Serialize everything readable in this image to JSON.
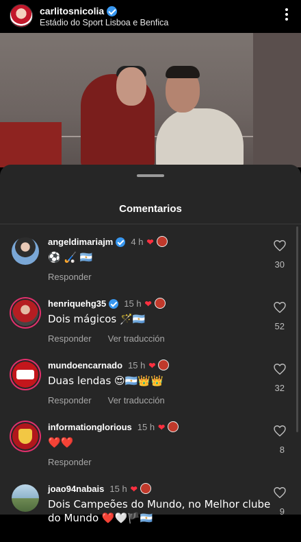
{
  "header": {
    "username": "carlitosnicolia",
    "location": "Estádio do Sport Lisboa e Benfica"
  },
  "sheet": {
    "title": "Comentarios"
  },
  "comments": [
    {
      "username": "angeldimariajm",
      "verified": true,
      "time": "4 h",
      "text": "⚽ 🏑 🇦🇷",
      "reply": "Responder",
      "translate": "",
      "likes": "30"
    },
    {
      "username": "henriquehg35",
      "verified": true,
      "time": "15 h",
      "text": "Dois mágicos 🪄🇦🇷",
      "reply": "Responder",
      "translate": "Ver traducción",
      "likes": "52"
    },
    {
      "username": "mundoencarnado",
      "verified": false,
      "time": "15 h",
      "text": "Duas lendas 😍🇦🇷👑👑",
      "reply": "Responder",
      "translate": "Ver traducción",
      "likes": "32"
    },
    {
      "username": "informationglorious",
      "verified": false,
      "time": "15 h",
      "text": "❤️❤️",
      "reply": "Responder",
      "translate": "",
      "likes": "8"
    },
    {
      "username": "joao94nabais",
      "verified": false,
      "time": "15 h",
      "text": "Dois Campeões do Mundo, no Melhor clube",
      "text2": "do Mundo ❤️🤍🏴🇦🇷",
      "reply": "",
      "translate": "",
      "likes": "9"
    }
  ]
}
